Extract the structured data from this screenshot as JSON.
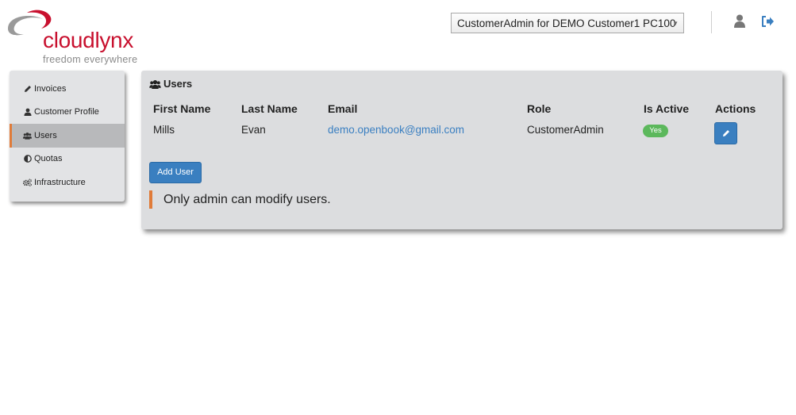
{
  "brand": {
    "name": "cloudlynx",
    "tagline": "freedom everywhere",
    "colors": {
      "brand_red": "#c8102e",
      "accent_orange": "#e07b39",
      "primary_blue": "#3a7fc0",
      "success_green": "#5cb85c"
    }
  },
  "header": {
    "account_selector": {
      "selected": "CustomerAdmin for DEMO Customer1 PC100"
    },
    "icons": [
      "user-icon",
      "logout-icon"
    ]
  },
  "sidebar": {
    "items": [
      {
        "label": "Invoices",
        "icon": "pencil-icon",
        "active": false
      },
      {
        "label": "Customer Profile",
        "icon": "user-icon",
        "active": false
      },
      {
        "label": "Users",
        "icon": "users-icon",
        "active": true
      },
      {
        "label": "Quotas",
        "icon": "half-circle-icon",
        "active": false
      },
      {
        "label": "Infrastructure",
        "icon": "cogs-icon",
        "active": false
      }
    ]
  },
  "main": {
    "title": "Users",
    "table": {
      "headers": [
        "First Name",
        "Last Name",
        "Email",
        "Role",
        "Is Active",
        "Actions"
      ],
      "rows": [
        {
          "first_name": "Mills",
          "last_name": "Evan",
          "email": "demo.openbook@gmail.com",
          "role": "CustomerAdmin",
          "is_active": "Yes"
        }
      ]
    },
    "add_user_label": "Add User",
    "notice": "Only admin can modify users."
  }
}
